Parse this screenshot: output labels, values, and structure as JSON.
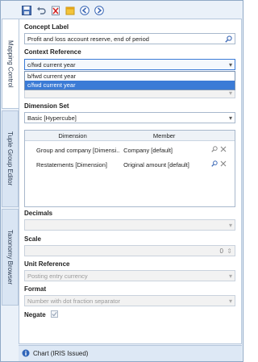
{
  "vertical_tabs": [
    "Mapping Control",
    "Tuple Group Editor",
    "Taxonomy Browser"
  ],
  "toolbar": {
    "icons": [
      "save-icon",
      "undo-icon",
      "delete-icon",
      "note-icon",
      "back-icon",
      "forward-icon"
    ]
  },
  "concept": {
    "label": "Concept Label",
    "value": "Profit and loss account reserve, end of period"
  },
  "context": {
    "label": "Context Reference",
    "selected": "c/fwd current year",
    "options": [
      "b/fwd current year",
      "c/fwd current year"
    ]
  },
  "dimension_set": {
    "label": "Dimension Set",
    "selected": "Basic [Hypercube]",
    "columns": [
      "Dimension",
      "Member"
    ],
    "rows": [
      {
        "dimension": "Group and company [Dimensi...",
        "member": "Company [default]"
      },
      {
        "dimension": "Restatements [Dimension]",
        "member": "Original amount [default]"
      }
    ]
  },
  "decimals": {
    "label": "Decimals",
    "value": ""
  },
  "scale": {
    "label": "Scale",
    "value": "0"
  },
  "unit": {
    "label": "Unit Reference",
    "value": "Posting entry currency"
  },
  "format": {
    "label": "Format",
    "value": "Number with dot fraction separator"
  },
  "negate": {
    "label": "Negate",
    "checked": true
  },
  "status_bar": {
    "text": "Chart (IRIS Issued)"
  }
}
